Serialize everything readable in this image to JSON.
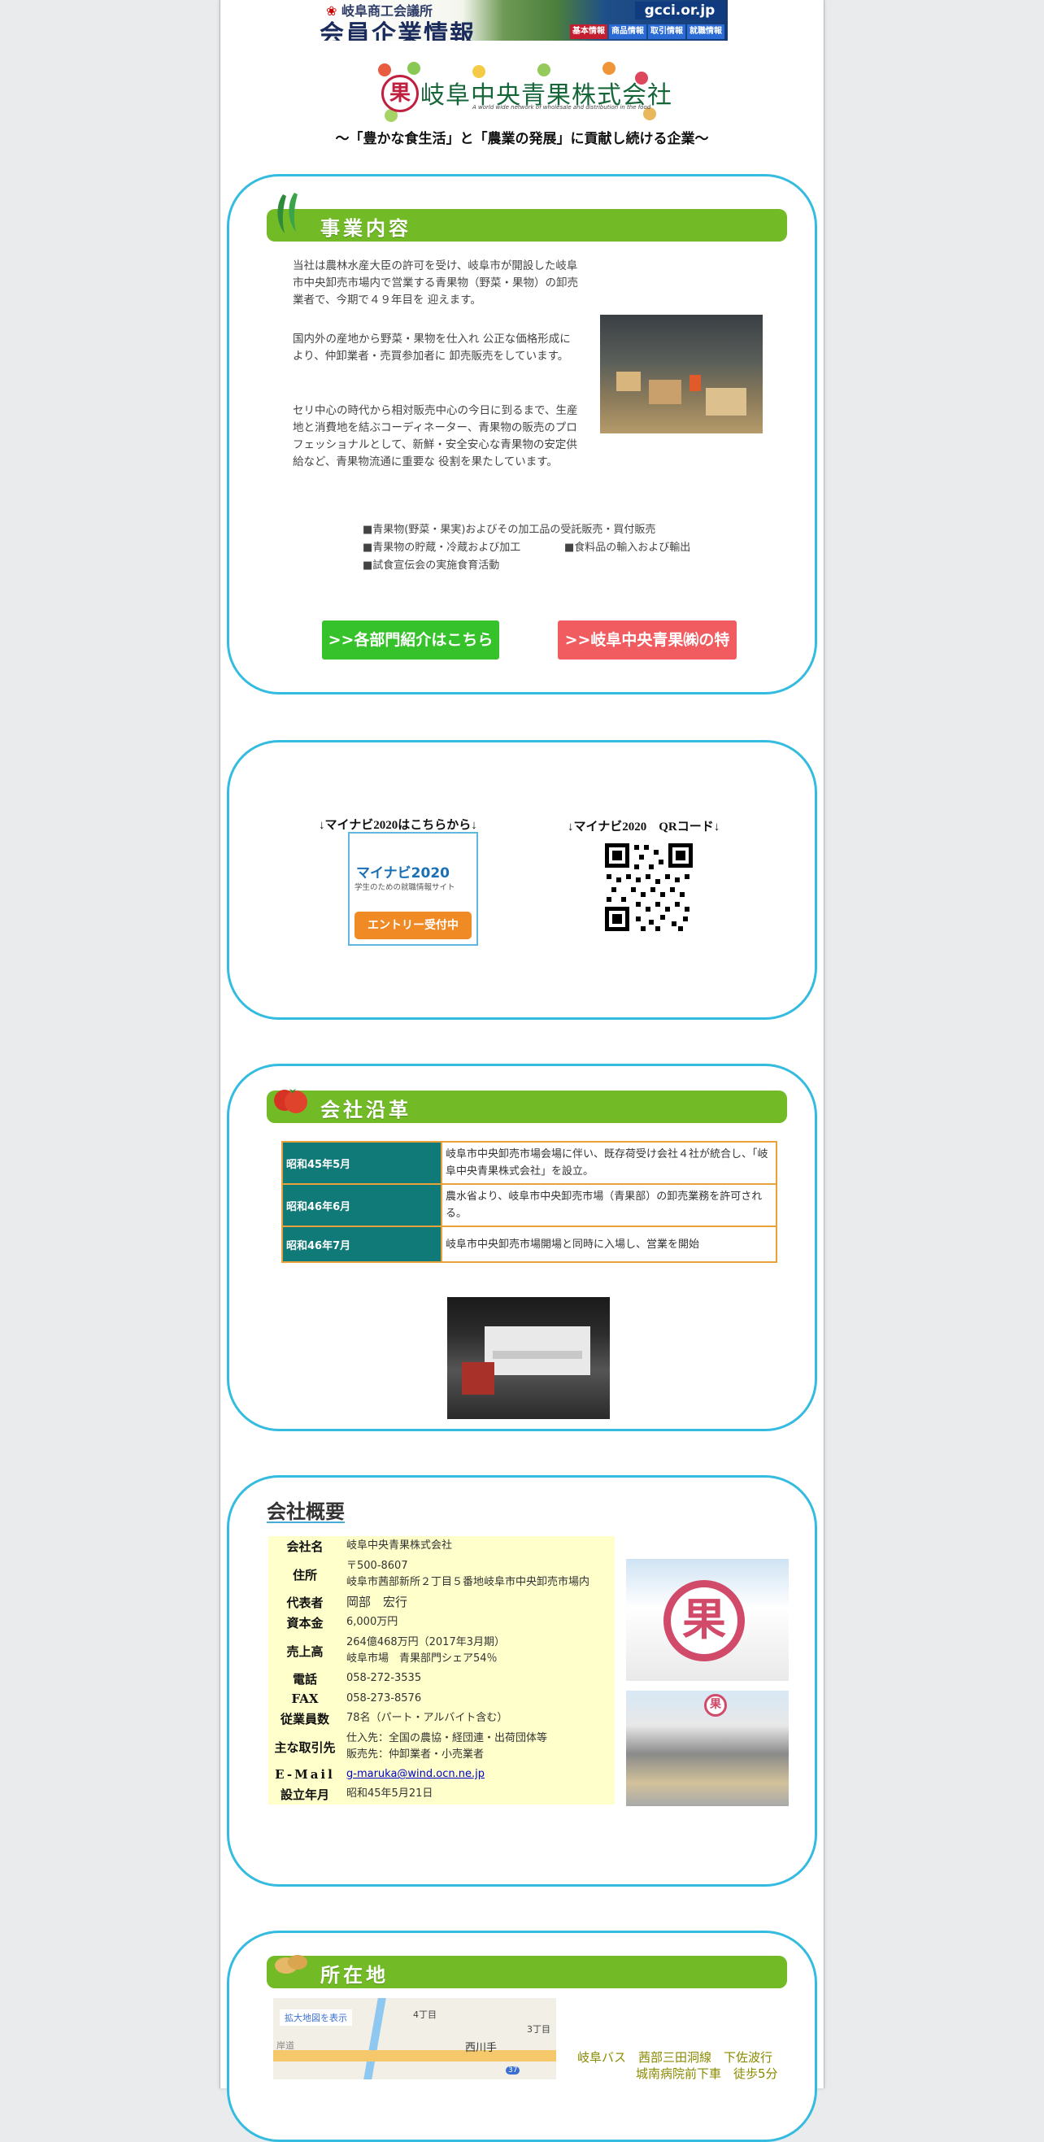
{
  "banner": {
    "org": "岐阜商工会議所",
    "title": "会員企業情報",
    "domain": "gcci.or.jp",
    "tabs": [
      "基本情報",
      "商品情報",
      "取引情報",
      "就職情報"
    ]
  },
  "logo": {
    "mark": "果",
    "name": "岐阜中央青果株式会社",
    "subtitle": "A world wide network of wholesale and distribution in the food"
  },
  "tagline": "～「豊かな食生活」と「農業の発展」に貢献し続ける企業～",
  "business": {
    "heading": "事業内容",
    "paragraphs": [
      "当社は農林水産大臣の許可を受け、岐阜市が開設した岐阜市中央卸売市場内で営業する青果物（野菜・果物）の卸売業者で、今期で４９年目を 迎えます。",
      "国内外の産地から野菜・果物を仕入れ 公正な価格形成により、仲卸業者・売買参加者に 卸売販売をしています。",
      "セリ中心の時代から相対販売中心の今日に到るまで、生産地と消費地を結ぶコーディネーター、青果物の販売のプロフェッショナルとして、新鮮・安全安心な青果物の安定供給など、青果物流通に重要な 役割を果たしています。"
    ],
    "items": [
      "■青果物(野菜・果実)およびその加工品の受託販売・買付販売",
      "■青果物の貯蔵・冷蔵および加工",
      "■食料品の輸入および輸出",
      "■試食宣伝会の実施食育活動"
    ],
    "button_departments": ">>各部門紹介はこちら",
    "button_features": ">>岐阜中央青果㈱の特徴"
  },
  "mynavi": {
    "label_entry": "↓マイナビ2020はこちらから↓",
    "label_qr": "↓マイナビ2020　QRコード↓",
    "badge_logo": "マイナビ2020",
    "badge_sub": "学生のための就職情報サイト",
    "badge_button": "エントリー受付中"
  },
  "history": {
    "heading": "会社沿革",
    "rows": [
      {
        "year": "昭和45年5月",
        "text": "岐阜市中央卸売市場会場に伴い、既存荷受け会社４社が統合し、「岐阜中央青果株式会社」を設立。"
      },
      {
        "year": "昭和46年6月",
        "text": "農水省より、岐阜市中央卸売市場（青果部）の卸売業務を許可される。"
      },
      {
        "year": "昭和46年7月",
        "text": "岐阜市中央卸売市場開場と同時に入場し、営業を開始"
      }
    ]
  },
  "overview": {
    "heading": "会社概要",
    "rows": [
      {
        "key": "会社名",
        "lines": [
          "岐阜中央青果株式会社"
        ]
      },
      {
        "key": "住所",
        "lines": [
          "〒500-8607",
          "岐阜市茜部新所２丁目５番地岐阜市中央卸売市場内"
        ]
      },
      {
        "key": "代表者",
        "lines": [
          "岡部　宏行"
        ]
      },
      {
        "key": "資本金",
        "lines": [
          "6,000万円"
        ]
      },
      {
        "key": "売上高",
        "lines": [
          "264億468万円（2017年3月期）",
          "岐阜市場　青果部門シェア54％"
        ]
      },
      {
        "key": "電話",
        "lines": [
          "058-272-3535"
        ]
      },
      {
        "key": "FAX",
        "lines": [
          "058-273-8576"
        ]
      },
      {
        "key": "従業員数",
        "lines": [
          "78名（パート・アルバイト含む）"
        ]
      },
      {
        "key": "主な取引先",
        "lines": [
          "仕入先：全国の農協・経団連・出荷団体等",
          "販売先：仲卸業者・小売業者"
        ]
      },
      {
        "key": "E-Mail",
        "lines": [
          "g-maruka@wind.ocn.ne.jp"
        ]
      },
      {
        "key": "設立年月",
        "lines": [
          "昭和45年5月21日"
        ]
      }
    ]
  },
  "location": {
    "heading": "所在地",
    "map_link": "拡大地図を表示",
    "map_labels": [
      "4丁目",
      "3丁目",
      "西川手",
      "岸道",
      "37"
    ],
    "access_line1": "岐阜バス　茜部三田洞線　下佐波行",
    "access_line2": "城南病院前下車　徒歩5分"
  },
  "colors": {
    "section_border": "#33bce0",
    "heading_bar": "#72bb27",
    "history_year_bg": "#0f7a78",
    "history_border": "#e9a23b",
    "overview_bg": "#ffffcc",
    "button_green": "#36c22a",
    "button_red": "#f05c5f"
  }
}
